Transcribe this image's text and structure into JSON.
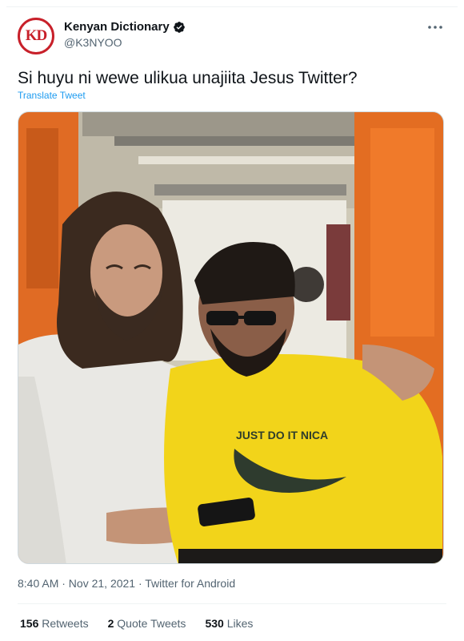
{
  "author": {
    "display_name": "Kenyan Dictionary",
    "handle": "@K3NYOO",
    "avatar_text": "KD",
    "verified": true
  },
  "tweet": {
    "text": "Si huyu ni wewe ulikua unajiita Jesus Twitter?",
    "translate_label": "Translate Tweet",
    "timestamp": "8:40 AM · Nov 21, 2021 · Twitter for Android",
    "photo_shirt_print": "JUST DO IT NICA"
  },
  "stats": {
    "retweets_count": "156",
    "retweets_label": "Retweets",
    "quotes_count": "2",
    "quotes_label": "Quote Tweets",
    "likes_count": "530",
    "likes_label": "Likes"
  },
  "colors": {
    "link": "#1d9bf0",
    "muted": "#536471",
    "avatar_ring": "#c8202a"
  },
  "icons": {
    "verified": "verified-badge-icon",
    "more": "more-dots-icon"
  }
}
